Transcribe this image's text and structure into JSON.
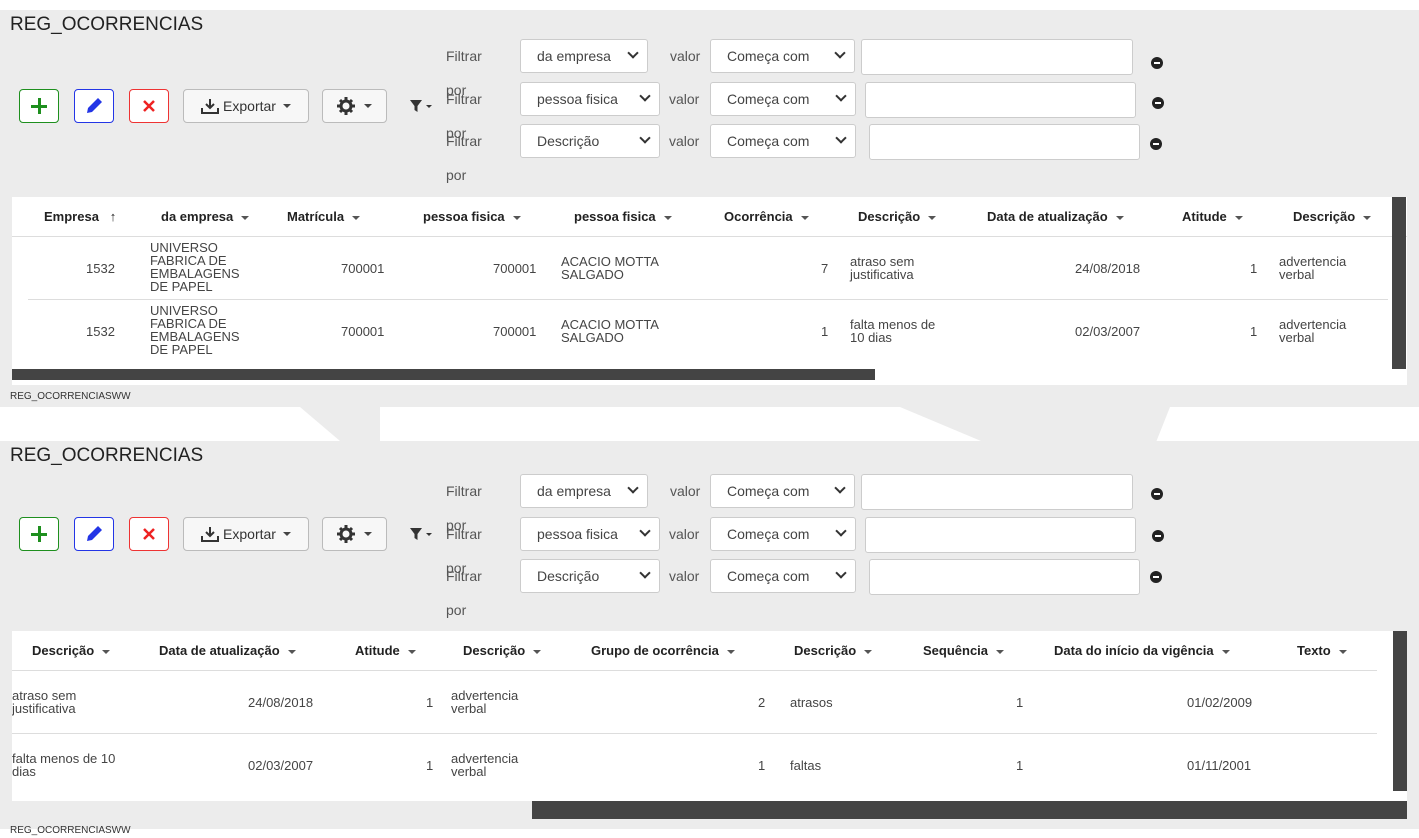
{
  "title": "REG_OCORRENCIAS",
  "footer": "REG_OCORRENCIASWW",
  "toolbar": {
    "add_icon": "plus-icon",
    "edit_icon": "pencil-icon",
    "delete_icon": "close-icon",
    "export_label": "Exportar",
    "settings_icon": "gear-icon",
    "filter_icon": "filter-icon"
  },
  "filters": [
    {
      "label": "Filtrar por",
      "field": "da empresa",
      "value_label": "valor",
      "op": "Começa com",
      "value": ""
    },
    {
      "label": "Filtrar por",
      "field": "pessoa fisica",
      "value_label": "valor",
      "op": "Começa com",
      "value": ""
    },
    {
      "label": "Filtrar por",
      "field": "Descrição",
      "value_label": "valor",
      "op": "Começa com",
      "value": ""
    }
  ],
  "colors": {
    "add": "#1e8f1e",
    "edit": "#2335e6",
    "delete": "#e22",
    "panel": "#ececec"
  },
  "grid1": {
    "headers": [
      "Empresa",
      "da empresa",
      "Matrícula",
      "pessoa fisica",
      "pessoa fisica",
      "Ocorrência",
      "Descrição",
      "Data de atualização",
      "Atitude",
      "Descrição"
    ],
    "sort_icon": "↑",
    "rows": [
      [
        "1532",
        "UNIVERSO FABRICA DE EMBALAGENS DE PAPEL",
        "700001",
        "700001",
        "ACACIO MOTTA SALGADO",
        "7",
        "atraso sem justificativa",
        "24/08/2018",
        "1",
        "advertencia verbal"
      ],
      [
        "1532",
        "UNIVERSO FABRICA DE EMBALAGENS DE PAPEL",
        "700001",
        "700001",
        "ACACIO MOTTA SALGADO",
        "1",
        "falta menos de 10 dias",
        "02/03/2007",
        "1",
        "advertencia verbal"
      ]
    ]
  },
  "grid2": {
    "headers": [
      "Descrição",
      "Data de atualização",
      "Atitude",
      "Descrição",
      "Grupo de ocorrência",
      "Descrição",
      "Sequência",
      "Data do início da vigência",
      "Texto"
    ],
    "rows": [
      [
        "atraso sem justificativa",
        "24/08/2018",
        "1",
        "advertencia verbal",
        "2",
        "atrasos",
        "1",
        "01/02/2009",
        ""
      ],
      [
        "falta menos de 10 dias",
        "02/03/2007",
        "1",
        "advertencia verbal",
        "1",
        "faltas",
        "1",
        "01/11/2001",
        ""
      ]
    ]
  }
}
